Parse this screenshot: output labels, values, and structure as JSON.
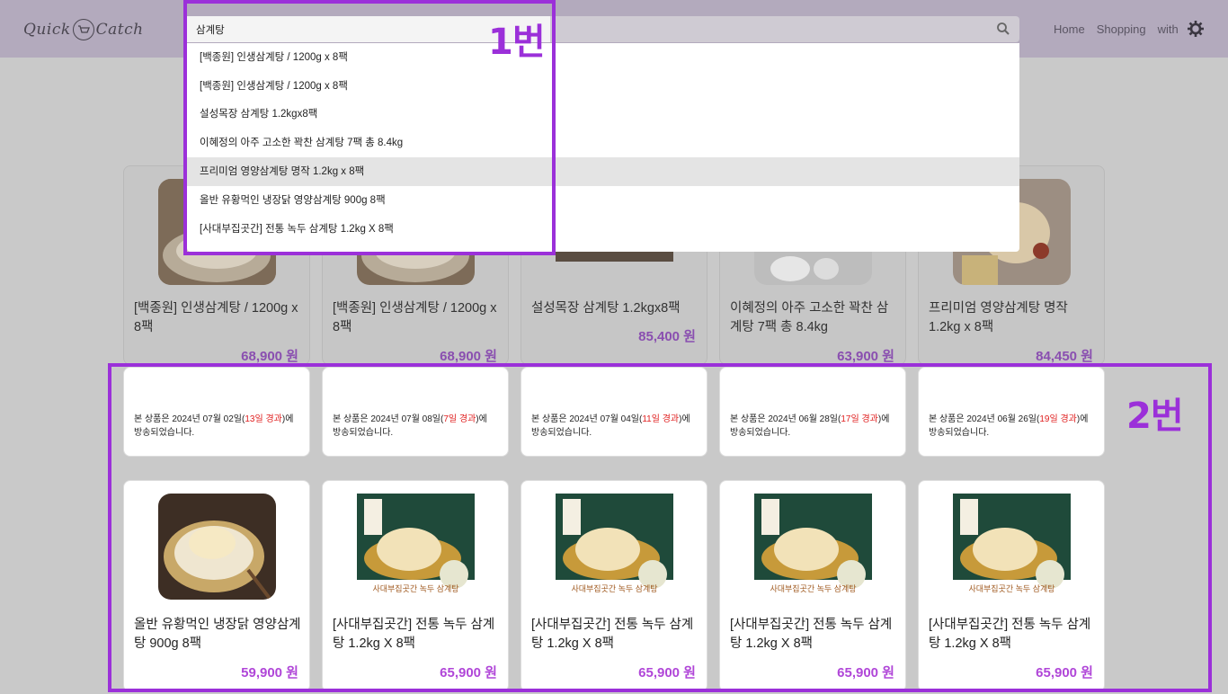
{
  "header": {
    "logo_text_left": "Quick",
    "logo_cart": "🛒",
    "logo_text_right": "Catch",
    "nav": [
      "Home",
      "Shopping",
      "with"
    ]
  },
  "search": {
    "value": "삼계탕",
    "suggestions": [
      "[백종원] 인생삼계탕 / 1200g x 8팩",
      "[백종원] 인생삼계탕 / 1200g x 8팩",
      "설성목장 삼계탕 1.2kgx8팩",
      "이혜정의 아주 고소한 꽉찬 삼계탕 7팩 총 8.4kg",
      "프리미엄 영양삼계탕 명작 1.2kg x 8팩",
      "올반 유황먹인 냉장닭 영양삼계탕 900g 8팩",
      "[사대부집곳간] 전통 녹두 삼계탕 1.2kg X 8팩"
    ],
    "active_index": 4
  },
  "products_top": [
    {
      "title": "[백종원] 인생삼계탕 / 1200g x 8팩",
      "price": "68,900 원"
    },
    {
      "title": "[백종원] 인생삼계탕 / 1200g x 8팩",
      "price": "68,900 원"
    },
    {
      "title": "설성목장 삼계탕 1.2kgx8팩",
      "price": "85,400 원"
    },
    {
      "title": "이혜정의 아주 고소한 꽉찬 삼계탕 7팩 총 8.4kg",
      "price": "63,900 원"
    },
    {
      "title": "프리미엄 영양삼계탕 명작 1.2kg x 8팩",
      "price": "84,450 원"
    }
  ],
  "notices": [
    {
      "prefix": "본 상품은 2024년 07월 02일(",
      "days": "13일 경과",
      "suffix": ")에 방송되었습니다."
    },
    {
      "prefix": "본 상품은 2024년 07월 08일(",
      "days": "7일 경과",
      "suffix": ")에 방송되었습니다."
    },
    {
      "prefix": "본 상품은 2024년 07월 04일(",
      "days": "11일 경과",
      "suffix": ")에 방송되었습니다."
    },
    {
      "prefix": "본 상품은 2024년 06월 28일(",
      "days": "17일 경과",
      "suffix": ")에 방송되었습니다."
    },
    {
      "prefix": "본 상품은 2024년 06월 26일(",
      "days": "19일 경과",
      "suffix": ")에 방송되었습니다."
    }
  ],
  "products_bottom": [
    {
      "title": "올반 유황먹인 냉장닭 영양삼계탕 900g 8팩",
      "price": "59,900 원"
    },
    {
      "title": "[사대부집곳간] 전통 녹두 삼계탕 1.2kg X 8팩",
      "price": "65,900 원",
      "img_caption": "사대부집곳간 녹두 삼계탕"
    },
    {
      "title": "[사대부집곳간] 전통 녹두 삼계탕 1.2kg X 8팩",
      "price": "65,900 원",
      "img_caption": "사대부집곳간 녹두 삼계탕"
    },
    {
      "title": "[사대부집곳간] 전통 녹두 삼계탕 1.2kg X 8팩",
      "price": "65,900 원",
      "img_caption": "사대부집곳간 녹두 삼계탕"
    },
    {
      "title": "[사대부집곳간] 전통 녹두 삼계탕 1.2kg X 8팩",
      "price": "65,900 원",
      "img_caption": "사대부집곳간 녹두 삼계탕"
    }
  ],
  "annotations": {
    "label1": "1번",
    "label2": "2번"
  },
  "colors": {
    "annotation": "#9b30d9",
    "price": "#b046d8",
    "header": "#b3aabd",
    "days": "#e02020"
  }
}
